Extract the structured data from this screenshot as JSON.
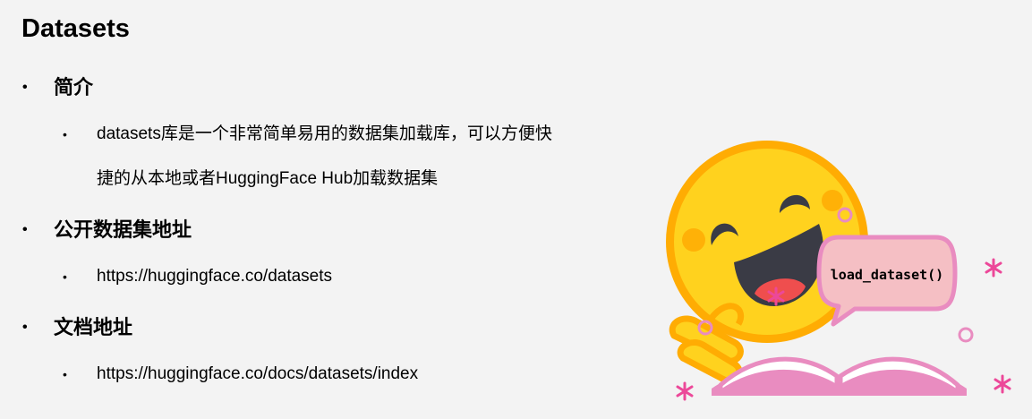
{
  "title": "Datasets",
  "sections": [
    {
      "heading": "简介",
      "items": [
        {
          "line1": "datasets库是一个非常简单易用的数据集加载库，可以方便快",
          "line2": "捷的从本地或者HuggingFace Hub加载数据集"
        }
      ]
    },
    {
      "heading": "公开数据集地址",
      "items": [
        {
          "line1": "https://huggingface.co/datasets"
        }
      ]
    },
    {
      "heading": "文档地址",
      "items": [
        {
          "line1": "https://huggingface.co/docs/datasets/index"
        }
      ]
    }
  ],
  "bullet_symbol": "•",
  "illustration": {
    "speech_bubble_text": "load_dataset()",
    "colors": {
      "face": "#FFD21E",
      "face_outline": "#FFAC03",
      "eyes": "#3A3B45",
      "tongue": "#EF4E4E",
      "book": "#E98CC0",
      "bubble_fill": "#F5BFC4",
      "sparkle": "#EC4899"
    }
  }
}
